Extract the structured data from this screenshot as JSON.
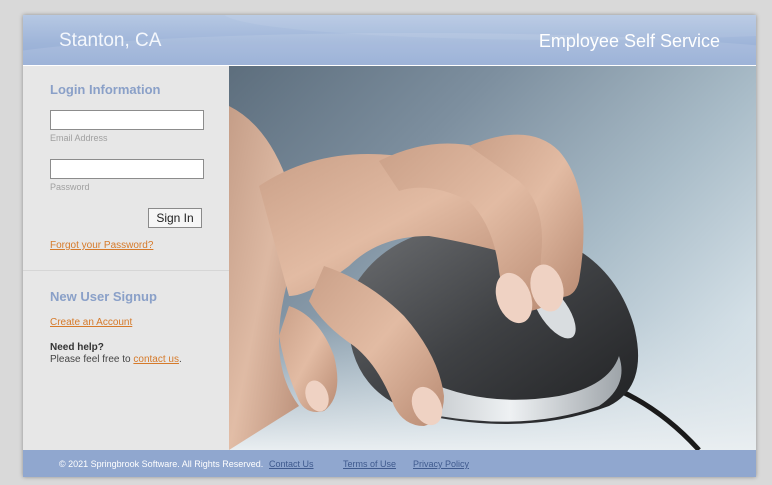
{
  "header": {
    "city": "Stanton, CA",
    "app_title": "Employee Self Service"
  },
  "login": {
    "section_title": "Login Information",
    "email_label": "Email Address",
    "email_value": "",
    "password_label": "Password",
    "password_value": "",
    "sign_in_label": "Sign In",
    "forgot_password": "Forgot your Password?"
  },
  "signup": {
    "section_title": "New User Signup",
    "create_account": "Create an Account",
    "need_help": "Need help?",
    "help_text": "Please feel free to",
    "contact_link": "contact us",
    "help_suffix": "."
  },
  "footer": {
    "copyright": "© 2021 Springbrook Software. All Rights Reserved.",
    "contact_us": "Contact Us",
    "terms": "Terms of Use",
    "privacy": "Privacy Policy"
  },
  "hero_image": {
    "icon": "hand-on-computer-mouse-photo"
  },
  "colors": {
    "header_bg": "#9fb5d9",
    "section_title": "#8aa0c8",
    "link": "#d67a2a",
    "footer_bg": "#90a7cf",
    "sidebar_bg": "#e7e7e7"
  }
}
